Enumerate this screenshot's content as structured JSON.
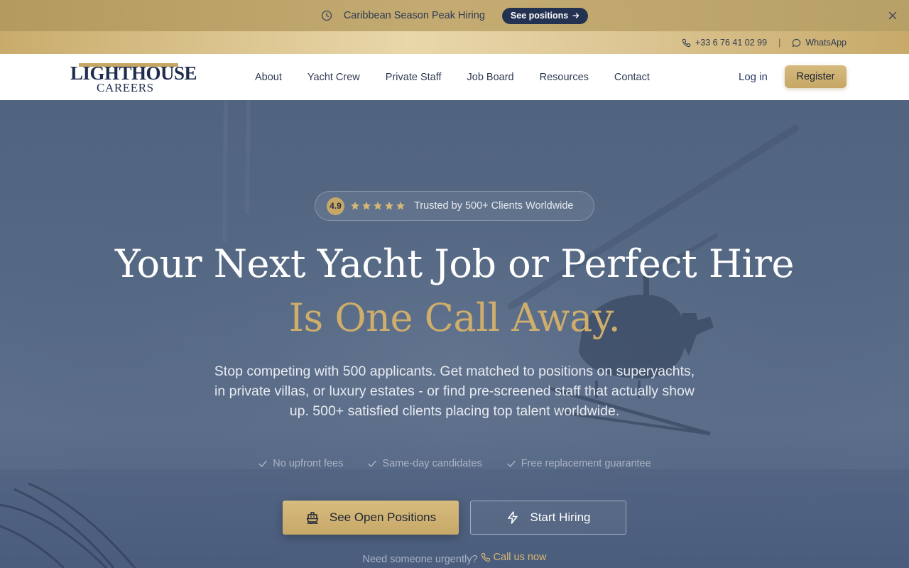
{
  "announcement": {
    "icon": "clock-icon",
    "text": "Caribbean Season Peak Hiring",
    "cta_label": "See positions",
    "cta_icon": "arrow-right-icon",
    "close_icon": "close-icon"
  },
  "contact_bar": {
    "phone": "+33 6 76 41 02 99",
    "phone_icon": "phone-icon",
    "separator": "|",
    "whatsapp": "WhatsApp",
    "whatsapp_icon": "chat-bubble-icon"
  },
  "nav": {
    "logo_line1": "LIGHTHOUSE",
    "logo_line2": "CAREERS",
    "items": [
      {
        "label": "About"
      },
      {
        "label": "Yacht Crew"
      },
      {
        "label": "Private Staff"
      },
      {
        "label": "Job Board"
      },
      {
        "label": "Resources"
      },
      {
        "label": "Contact"
      }
    ],
    "login_label": "Log in",
    "register_label": "Register"
  },
  "hero": {
    "rating_score": "4.9",
    "rating_stars": 5,
    "rating_text": "Trusted by 500+ Clients Worldwide",
    "headline_line1": "Your Next Yacht Job or Perfect Hire",
    "headline_line2": "Is One Call Away.",
    "subtitle": "Stop competing with 500 applicants. Get matched to positions on superyachts, in private villas, or luxury estates - or find pre-screened staff that actually show up. 500+ satisfied clients placing top talent worldwide.",
    "perks": [
      {
        "label": "No upfront fees",
        "icon": "check-icon"
      },
      {
        "label": "Same-day candidates",
        "icon": "check-icon"
      },
      {
        "label": "Free replacement guarantee",
        "icon": "check-icon"
      }
    ],
    "primary_cta": "See Open Positions",
    "primary_icon": "ship-icon",
    "secondary_cta": "Start Hiring",
    "secondary_icon": "lightning-icon",
    "urgent_text": "Need someone urgently?",
    "urgent_link": "Call us now",
    "urgent_icon": "phone-icon"
  },
  "colors": {
    "navy": "#243252",
    "gold": "#c6a767",
    "hero_overlay": "#52657f"
  }
}
